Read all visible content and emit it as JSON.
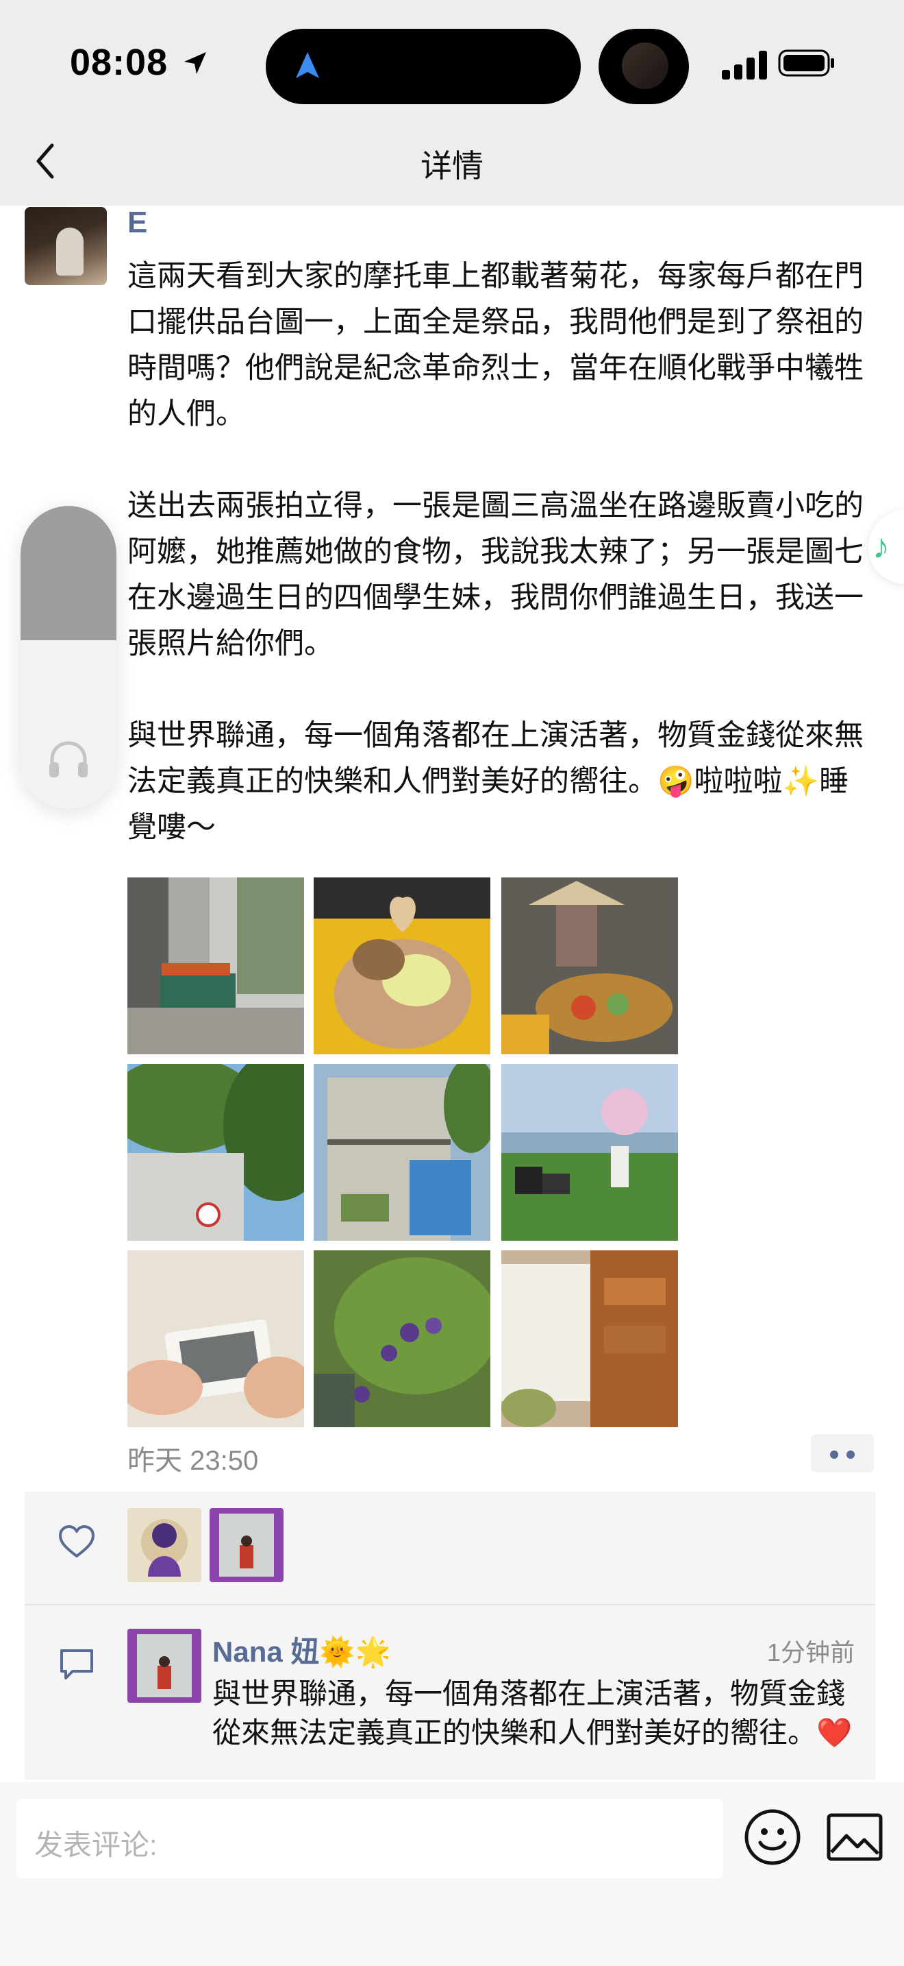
{
  "status_bar": {
    "time": "08:08"
  },
  "nav": {
    "title": "详情"
  },
  "post": {
    "author": "E",
    "text": "這兩天看到大家的摩托車上都載著菊花，每家每戶都在門口擺供品台圖一，上面全是祭品，我問他們是到了祭祖的時間嗎？他們說是紀念革命烈士，當年在順化戰爭中犧牲的人們。\n\n送出去兩張拍立得，一張是圖三高溫坐在路邊販賣小吃的阿嬤，她推薦她做的食物，我說我太辣了；另一張是圖七在水邊過生日的四個學生妹，我問你們誰過生日，我送一張照片給你們。\n\n與世界聯通，每一個角落都在上演活著，物質金錢從來無法定義真正的快樂和人們對美好的嚮往。🤪啦啦啦✨睡覺嘍～",
    "timestamp": "昨天 23:50"
  },
  "comments": [
    {
      "name": "Nana 妞🌞🌟",
      "time": "1分钟前",
      "text": "與世界聯通，每一個角落都在上演活著，物質金錢從來無法定義真正的快樂和人們對美好的嚮往。❤️"
    }
  ],
  "input": {
    "placeholder": "发表评论:"
  },
  "colors": {
    "link": "#576b95",
    "background": "#ededed",
    "music": "#3cc98a"
  }
}
